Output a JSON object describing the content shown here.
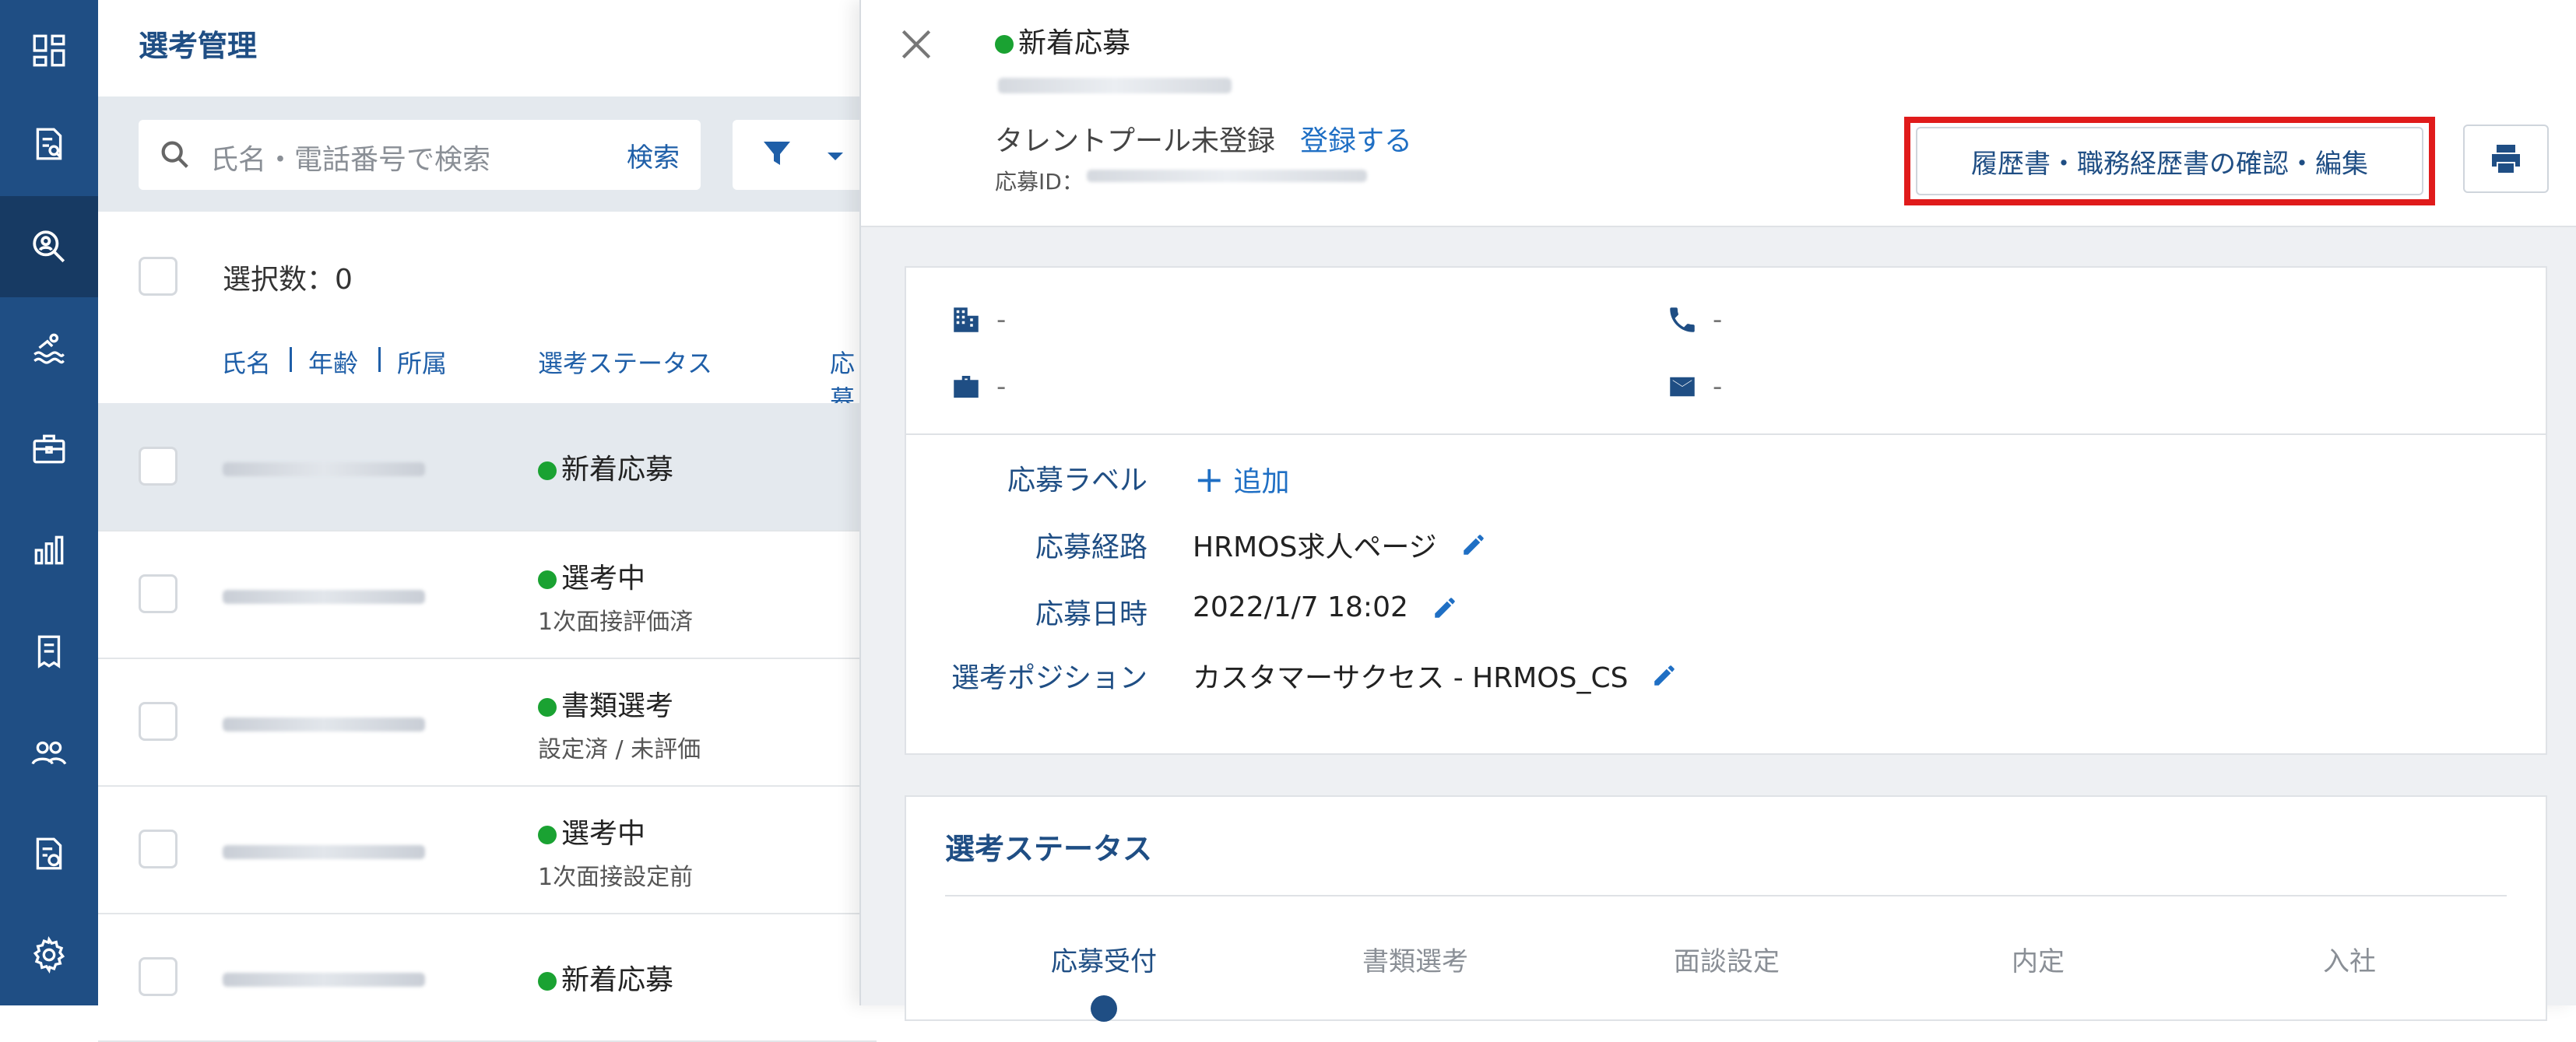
{
  "page": {
    "title": "選考管理"
  },
  "sidebar": {
    "items": [
      {
        "icon": "dashboard-icon"
      },
      {
        "icon": "document-search-icon"
      },
      {
        "icon": "candidate-search-icon",
        "active": true
      },
      {
        "icon": "swimmer-icon"
      },
      {
        "icon": "briefcase-icon"
      },
      {
        "icon": "bar-chart-icon"
      },
      {
        "icon": "report-icon"
      },
      {
        "icon": "people-icon"
      },
      {
        "icon": "document-settings-icon"
      },
      {
        "icon": "gear-icon"
      }
    ]
  },
  "search": {
    "placeholder": "氏名・電話番号で検索",
    "button_label": "検索"
  },
  "list": {
    "select_count_label": "選択数：0",
    "columns": {
      "name": "氏名",
      "age": "年齢",
      "affiliation": "所属",
      "status": "選考ステータス",
      "extra": "応募"
    },
    "rows": [
      {
        "status": "新着応募",
        "sub": ""
      },
      {
        "status": "選考中",
        "sub": "1次面接評価済"
      },
      {
        "status": "書類選考",
        "sub": "設定済 / 未評価"
      },
      {
        "status": "選考中",
        "sub": "1次面接設定前"
      },
      {
        "status": "新着応募",
        "sub": ""
      }
    ]
  },
  "detail": {
    "status": "新着応募",
    "talent_pool_text": "タレントプール未登録",
    "register_link": "登録する",
    "application_id_label": "応募ID：",
    "resume_button": "履歴書・職務経歴書の確認・編集",
    "contacts": {
      "company": "-",
      "phone": "-",
      "job": "-",
      "email": "-"
    },
    "fields": {
      "label_label": "応募ラベル",
      "add_link": "追加",
      "route_label": "応募経路",
      "route_value": "HRMOS求人ページ",
      "date_label": "応募日時",
      "date_value": "2022/1/7 18:02",
      "position_label": "選考ポジション",
      "position_value": "カスタマーサクセス - HRMOS_CS"
    },
    "selection_status": {
      "title": "選考ステータス",
      "steps": [
        "応募受付",
        "書類選考",
        "面談設定",
        "内定",
        "入社"
      ]
    }
  },
  "colors": {
    "sidebar": "#1f4e84",
    "accent": "#1f6fc4",
    "status_green": "#1aa232",
    "highlight_red": "#e01b1b"
  }
}
